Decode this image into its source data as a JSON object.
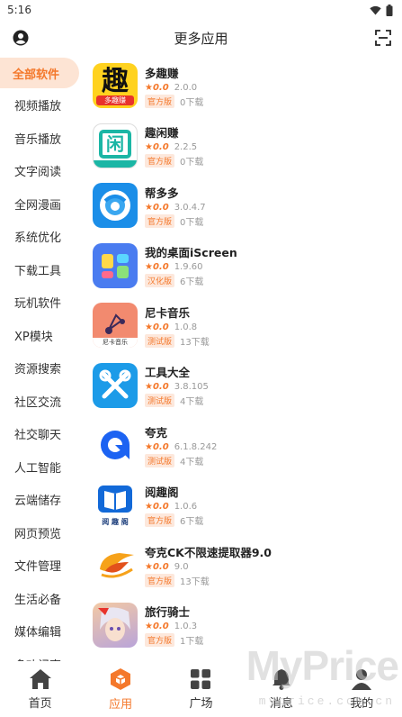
{
  "status_bar": {
    "time": "5:16"
  },
  "header": {
    "title": "更多应用"
  },
  "sidebar": {
    "items": [
      {
        "label": "全部软件",
        "active": true
      },
      {
        "label": "视频播放"
      },
      {
        "label": "音乐播放"
      },
      {
        "label": "文字阅读"
      },
      {
        "label": "全网漫画"
      },
      {
        "label": "系统优化"
      },
      {
        "label": "下载工具"
      },
      {
        "label": "玩机软件"
      },
      {
        "label": "XP模块"
      },
      {
        "label": "资源搜索"
      },
      {
        "label": "社区交流"
      },
      {
        "label": "社交聊天"
      },
      {
        "label": "人工智能"
      },
      {
        "label": "云端储存"
      },
      {
        "label": "网页预览"
      },
      {
        "label": "文件管理"
      },
      {
        "label": "生活必备"
      },
      {
        "label": "媒体编辑"
      },
      {
        "label": "多功记事"
      }
    ]
  },
  "apps": [
    {
      "name": "多趣赚",
      "rating": "0.0",
      "version": "2.0.0",
      "badge": "官方版",
      "downloads": "0下载",
      "icon": "duoquzhuan-icon"
    },
    {
      "name": "趣闲赚",
      "rating": "0.0",
      "version": "2.2.5",
      "badge": "官方版",
      "downloads": "0下载",
      "icon": "quxianzhuan-icon"
    },
    {
      "name": "帮多多",
      "rating": "0.0",
      "version": "3.0.4.7",
      "badge": "官方版",
      "downloads": "0下载",
      "icon": "bangduoduo-icon"
    },
    {
      "name": "我的桌面iScreen",
      "rating": "0.0",
      "version": "1.9.60",
      "badge": "汉化版",
      "downloads": "6下载",
      "icon": "iscreen-icon"
    },
    {
      "name": "尼卡音乐",
      "rating": "0.0",
      "version": "1.0.8",
      "badge": "测试版",
      "downloads": "13下载",
      "icon": "nika-music-icon"
    },
    {
      "name": "工具大全",
      "rating": "0.0",
      "version": "3.8.105",
      "badge": "测试版",
      "downloads": "4下载",
      "icon": "tools-icon"
    },
    {
      "name": "夸克",
      "rating": "0.0",
      "version": "6.1.8.242",
      "badge": "测试版",
      "downloads": "4下载",
      "icon": "quark-icon"
    },
    {
      "name": "阅趣阁",
      "rating": "0.0",
      "version": "1.0.6",
      "badge": "官方版",
      "downloads": "6下载",
      "icon": "yuequge-icon"
    },
    {
      "name": "夸克CK不限速提取器9.0",
      "rating": "0.0",
      "version": "9.0",
      "badge": "官方版",
      "downloads": "13下载",
      "icon": "quark-ck-icon"
    },
    {
      "name": "旅行骑士",
      "rating": "0.0",
      "version": "1.0.3",
      "badge": "官方版",
      "downloads": "1下载",
      "icon": "travel-knight-icon"
    }
  ],
  "icon_text": {
    "duoquzhuan": "多趣赚",
    "quxianzhuan": "闲",
    "nika": "尼卡音乐",
    "yuequge": "阅 趣 阁"
  },
  "tabs": [
    {
      "label": "首页",
      "icon": "home-icon"
    },
    {
      "label": "应用",
      "icon": "apps-cube-icon",
      "active": true
    },
    {
      "label": "广场",
      "icon": "grid-icon"
    },
    {
      "label": "消息",
      "icon": "bell-icon"
    },
    {
      "label": "我的",
      "icon": "person-icon"
    }
  ],
  "watermark": {
    "brand": "MyPrice",
    "url": "myprice.com.cn"
  },
  "colors": {
    "accent": "#f4782b",
    "accent_light": "#fde4d4"
  }
}
